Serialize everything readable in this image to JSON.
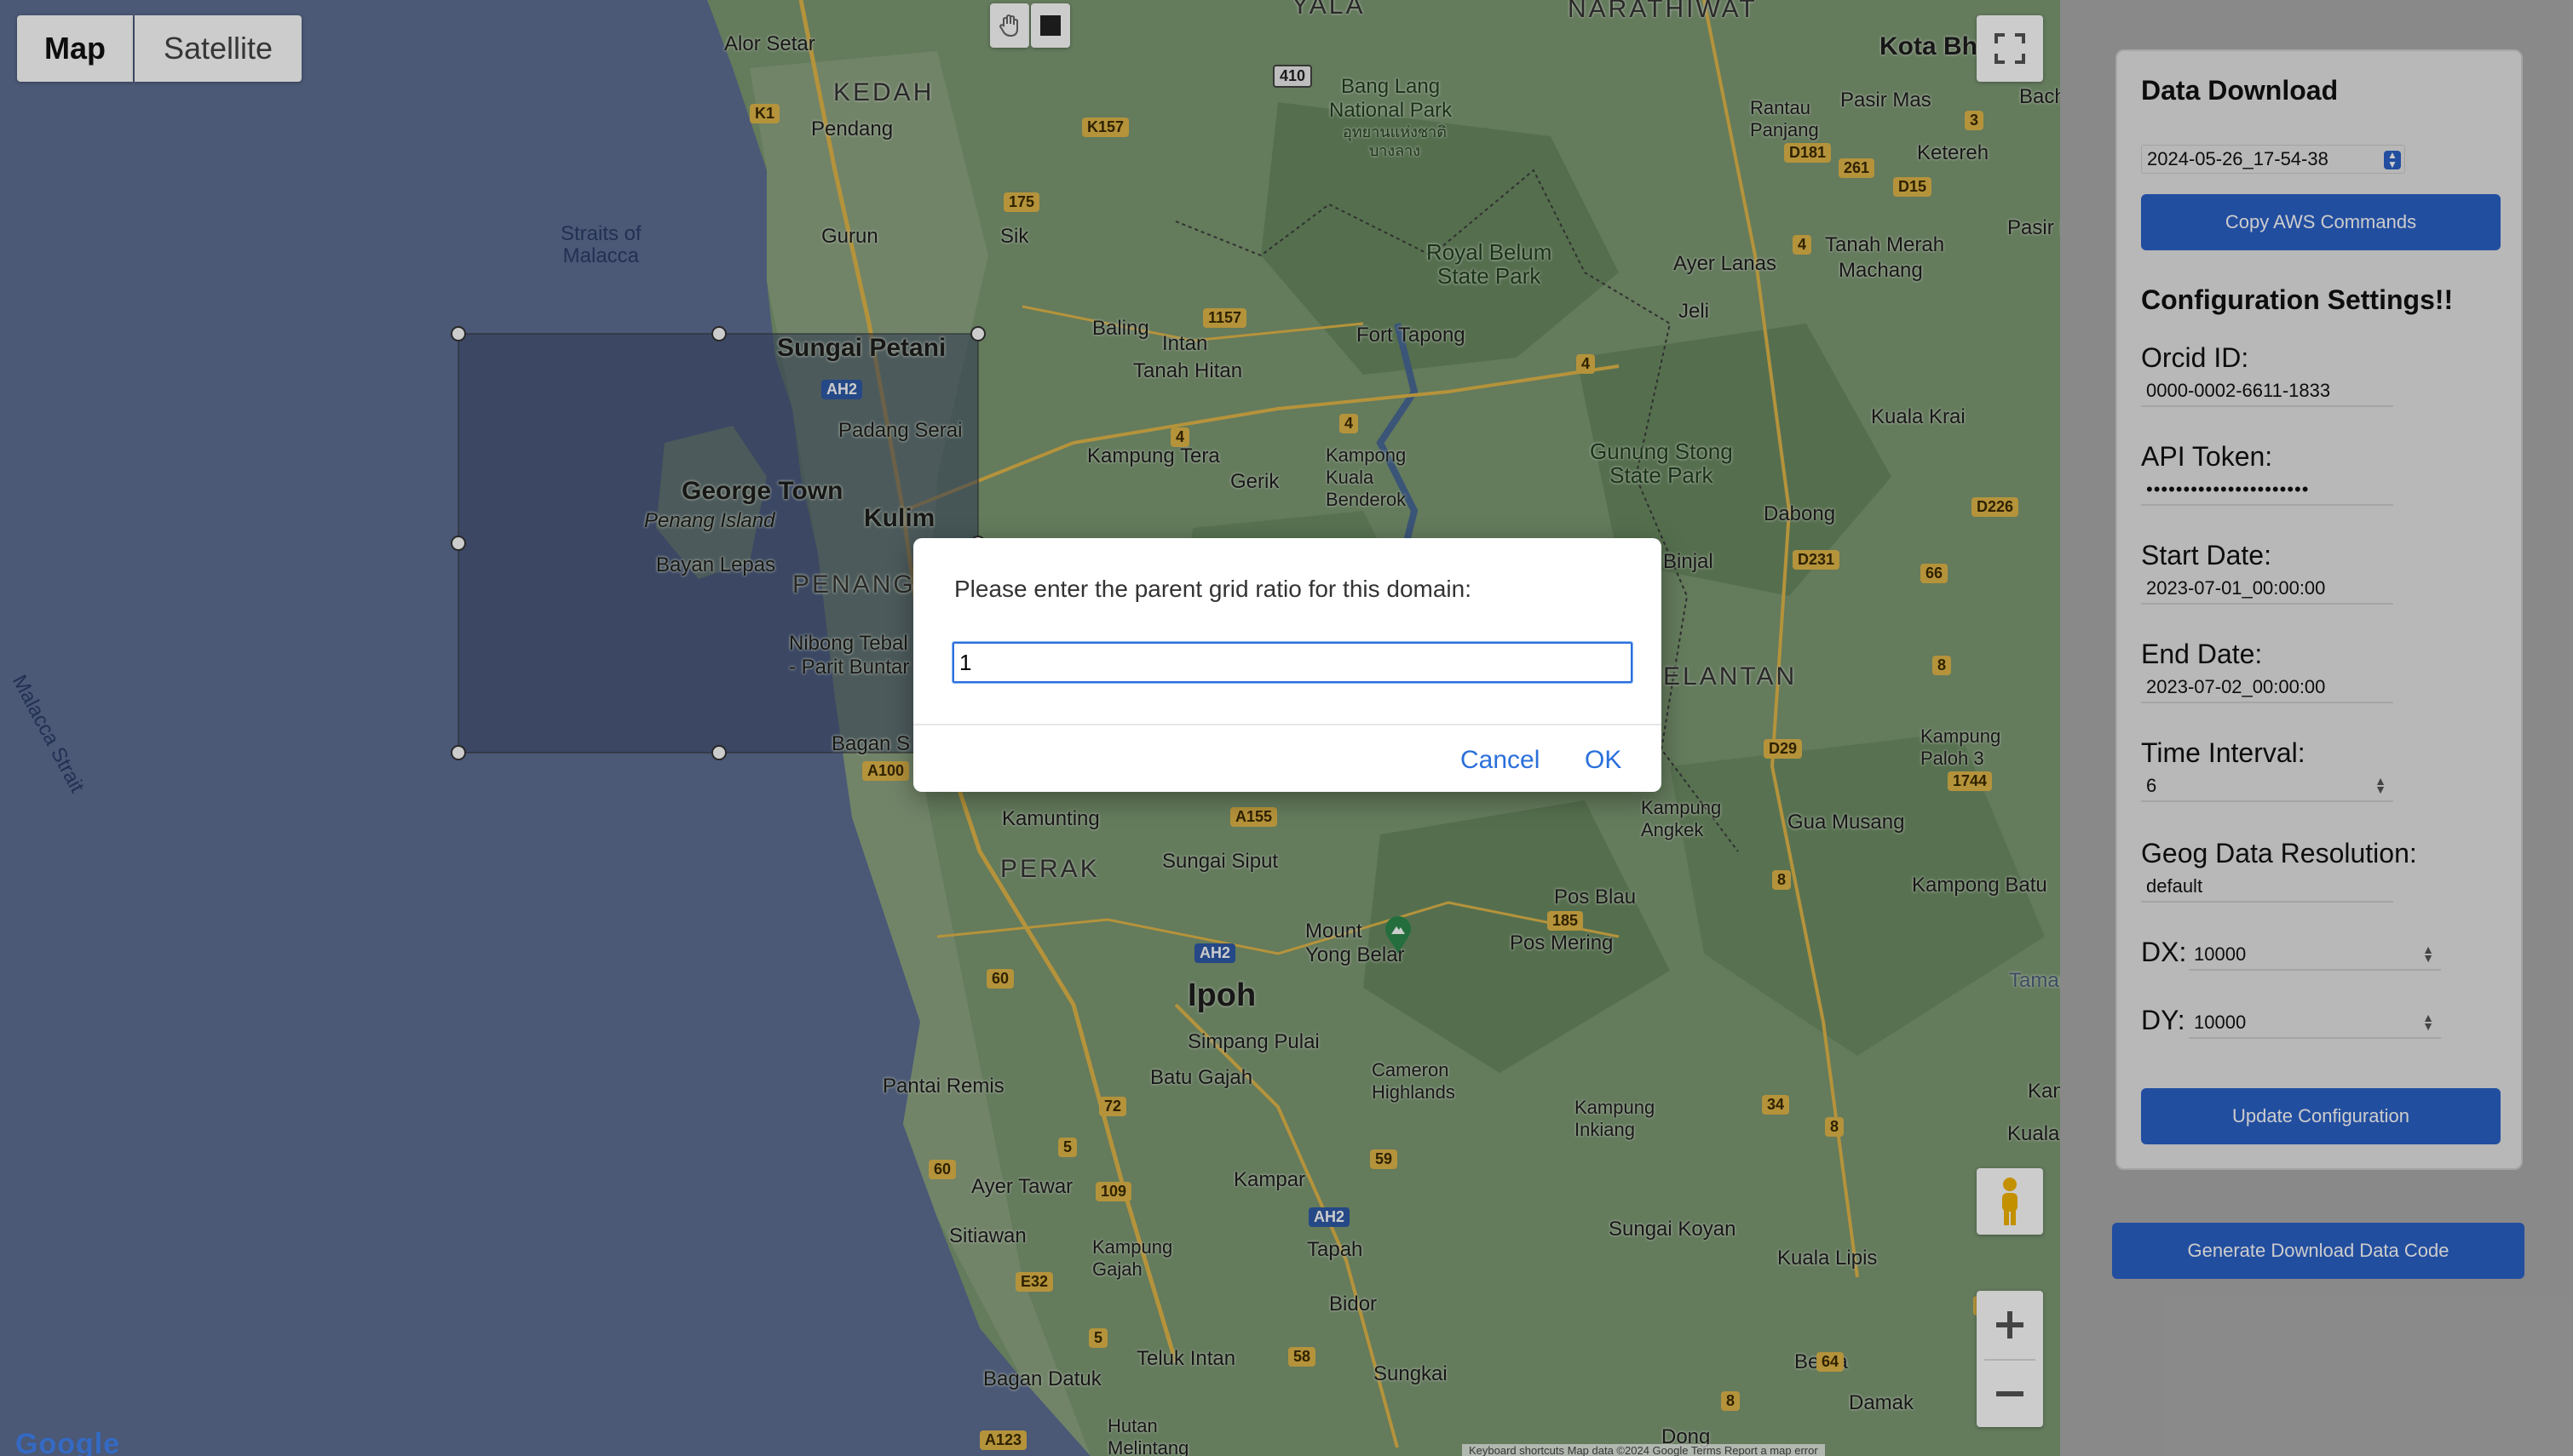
{
  "map": {
    "type_buttons": {
      "map": "Map",
      "satellite": "Satellite"
    },
    "labels": {
      "alor_setar": "Alor Setar",
      "kedah": "KEDAH",
      "pendang": "Pendang",
      "yala": "YALA",
      "narathiwat": "NARATHIWAT",
      "kota_bharu": "Kota Bha",
      "bang_lang": "Bang Lang\nNational Park",
      "bang_lang_thai": "อุทยานแห่งชาติ\nบางลาง",
      "straits": "Straits of\nMalacca",
      "gurun": "Gurun",
      "sik": "Sik",
      "royal_belum": "Royal Belum\nState Park",
      "ayer_lanas": "Ayer Lanas",
      "tanah_merah": "Tanah Merah",
      "machang": "Machang",
      "jeli": "Jeli",
      "sungai_petani": "Sungai Petani",
      "baling": "Baling",
      "intan": "Intan",
      "tanah_hitan": "Tanah Hitan",
      "fort_tapong": "Fort Tapong",
      "padang_serai": "Padang Serai",
      "george_town": "George Town",
      "penang_island": "Penang Island",
      "kulim": "Kulim",
      "bayan_lepas": "Bayan Lepas",
      "penang": "PENANG",
      "kampung_tera": "Kampung Tera",
      "gerik": "Gerik",
      "kampong_kuala": "Kampong\nKuala\nBenderok",
      "gunung_stong": "Gunung Stong\nState Park",
      "kuala_krai": "Kuala Krai",
      "dabong": "Dabong",
      "bukit_binjal": "Binjal",
      "kelantan": "ELANTAN",
      "nibong_tebal": "Nibong Tebal\n- Parit Buntar",
      "bagan_serai": "Bagan S",
      "kamunting": "Kamunting",
      "perak": "PERAK",
      "sungai_siput": "Sungai Siput",
      "kampung_angkek": "Kampung\nAngkek",
      "gua_musang": "Gua Musang",
      "kampung_paloh": "Kampung\nPaloh 3",
      "mount_yong": "Mount\nYong Belar",
      "pos_blau": "Pos Blau",
      "pos_mering": "Pos Mering",
      "kampong_batu": "Kampong Batu",
      "ipoh": "Ipoh",
      "simpang_pulai": "Simpang Pulai",
      "pantai_remis": "Pantai Remis",
      "batu_gajah": "Batu Gajah",
      "cameron": "Cameron\nHighlands",
      "kampung_inkiang": "Kampung\nInkiang",
      "ayer_tawar": "Ayer Tawar",
      "kampar": "Kampar",
      "sitiawan": "Sitiawan",
      "kampung_gajah": "Kampung\nGajah",
      "tapah": "Tapah",
      "sungai_koyan": "Sungai Koyan",
      "kuala_lipis": "Kuala Lipis",
      "bidor": "Bidor",
      "teluk_intan": "Teluk Intan",
      "sungkai": "Sungkai",
      "bentа": "Benta",
      "bagan_datuk": "Bagan Datuk",
      "hutan_melintang": "Hutan\nMelintang",
      "damak": "Damak",
      "dong": "Dong",
      "malacca_strait": "Malacca Strait",
      "rantau_panjang": "Rantau\nPanjang",
      "pasir_mas": "Pasir Mas",
      "ketereh": "Ketereh",
      "pasir_p": "Pasir P",
      "bacho": "Bacho",
      "taman_n": "Taman N",
      "kan": "Kan",
      "kuala_ta": "Kuala Ta",
      "h": "H"
    },
    "google": "Google",
    "attribution": "Keyboard shortcuts   Map data ©2024 Google   Terms   Report a map error"
  },
  "dialog": {
    "message": "Please enter the parent grid ratio for this domain:",
    "input_value": "1",
    "cancel": "Cancel",
    "ok": "OK"
  },
  "panel": {
    "title": "Data Download",
    "download_select": "2024-05-26_17-54-38",
    "copy_aws": "Copy AWS Commands",
    "config_title": "Configuration Settings!!",
    "orcid_label": "Orcid ID:",
    "orcid_value": "0000-0002-6611-1833",
    "token_label": "API Token:",
    "token_value": "••••••••••••••••••••••",
    "start_label": "Start Date:",
    "start_value": "2023-07-01_00:00:00",
    "end_label": "End Date:",
    "end_value": "2023-07-02_00:00:00",
    "interval_label": "Time Interval:",
    "interval_value": "6",
    "geog_label": "Geog Data Resolution:",
    "geog_value": "default",
    "dx_label": "DX:",
    "dx_value": "10000",
    "dy_label": "DY:",
    "dy_value": "10000",
    "update_btn": "Update Configuration"
  },
  "generate_btn": "Generate Download Data Code",
  "colors": {
    "sea": "#5e6f94",
    "land": "#7d9a74",
    "accent": "#2b62c8",
    "dialog_link": "#2a6fdb"
  }
}
